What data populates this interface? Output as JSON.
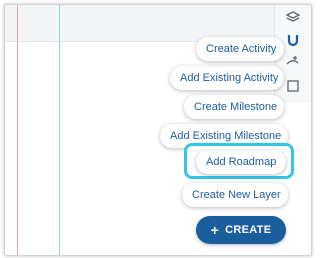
{
  "menu": {
    "items": [
      {
        "label": "Create Activity"
      },
      {
        "label": "Add Existing Activity"
      },
      {
        "label": "Create Milestone"
      },
      {
        "label": "Add Existing Milestone"
      },
      {
        "label": "Add Roadmap"
      },
      {
        "label": "Create New Layer"
      }
    ],
    "highlighted_item": "Add Roadmap"
  },
  "create_button": {
    "icon": "+",
    "label": "CREATE"
  },
  "toolbar": {
    "icons": [
      "layers-icon",
      "magnet-icon",
      "add-link-icon",
      "swimlane-icon"
    ]
  },
  "colors": {
    "primary": "#1b5e9e",
    "highlight": "#33c6ea",
    "guide_red": "#f1a0a6",
    "guide_cyan": "#8ad6df"
  }
}
